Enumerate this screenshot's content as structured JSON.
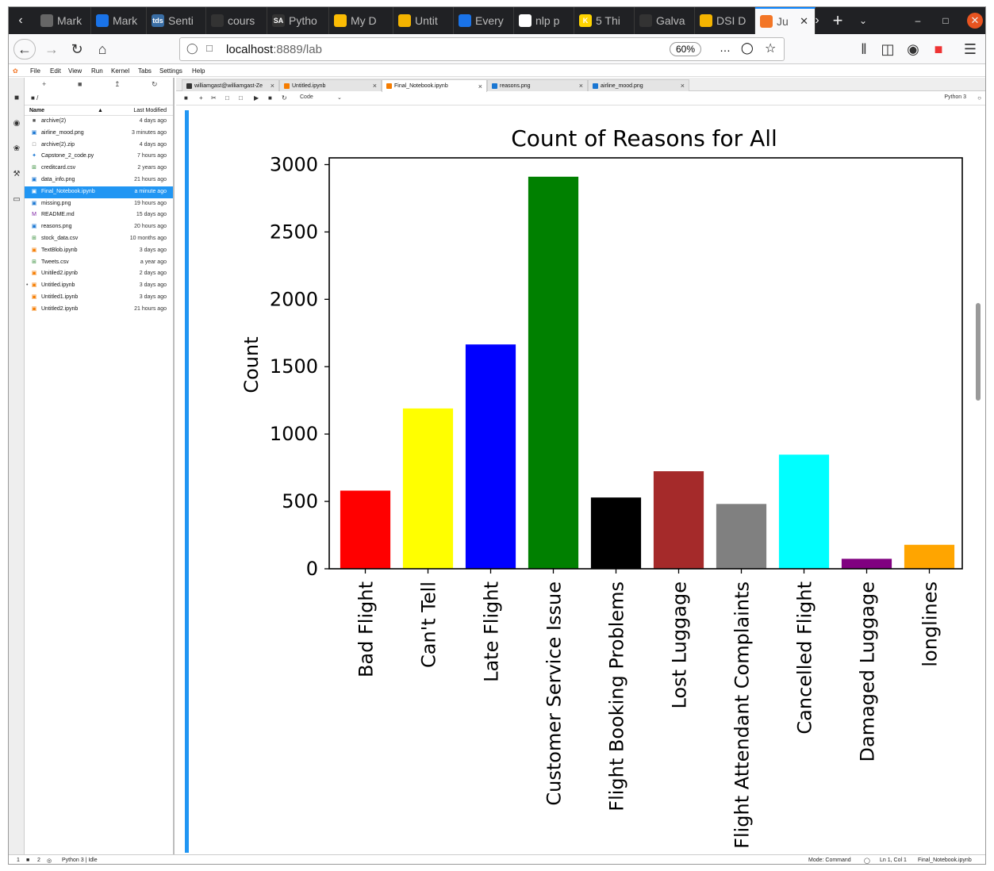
{
  "browser": {
    "tabs": [
      {
        "label": "Mark",
        "color": "#666"
      },
      {
        "label": "Mark",
        "color": "#1a73e8"
      },
      {
        "label": "Senti",
        "color": "#3a6ea5",
        "badge": "tds"
      },
      {
        "label": "cours",
        "color": "#333"
      },
      {
        "label": "Pytho",
        "color": "#333",
        "badge": "SA"
      },
      {
        "label": "My D",
        "color": "#fbbc04"
      },
      {
        "label": "Untit",
        "color": "#f4b400"
      },
      {
        "label": "Every",
        "color": "#1a73e8"
      },
      {
        "label": "nlp p",
        "color": "#fff"
      },
      {
        "label": "5 Thi",
        "color": "#ffd400",
        "badge": "K"
      },
      {
        "label": "Galva",
        "color": "#333"
      },
      {
        "label": "DSI D",
        "color": "#f4b400"
      },
      {
        "label": "Ju",
        "color": "#f37626"
      }
    ],
    "url_host": "localhost",
    "url_path": ":8889/lab",
    "zoom": "60%"
  },
  "menu": [
    "File",
    "Edit",
    "View",
    "Run",
    "Kernel",
    "Tabs",
    "Settings",
    "Help"
  ],
  "filebrowser": {
    "breadcrumb": "/",
    "col_name": "Name",
    "col_modified": "Last Modified",
    "files": [
      {
        "name": "archive(2)",
        "modified": "4 days ago",
        "type": "folder"
      },
      {
        "name": "airline_mood.png",
        "modified": "3 minutes ago",
        "type": "image"
      },
      {
        "name": "archive(2).zip",
        "modified": "4 days ago",
        "type": "file"
      },
      {
        "name": "Capstone_2_code.py",
        "modified": "7 hours ago",
        "type": "python"
      },
      {
        "name": "creditcard.csv",
        "modified": "2 years ago",
        "type": "csv"
      },
      {
        "name": "data_info.png",
        "modified": "21 hours ago",
        "type": "image"
      },
      {
        "name": "Final_Notebook.ipynb",
        "modified": "a minute ago",
        "type": "notebook",
        "selected": true
      },
      {
        "name": "missing.png",
        "modified": "19 hours ago",
        "type": "image"
      },
      {
        "name": "README.md",
        "modified": "15 days ago",
        "type": "markdown"
      },
      {
        "name": "reasons.png",
        "modified": "20 hours ago",
        "type": "image"
      },
      {
        "name": "stock_data.csv",
        "modified": "10 months ago",
        "type": "csv"
      },
      {
        "name": "TextBlob.ipynb",
        "modified": "3 days ago",
        "type": "notebook"
      },
      {
        "name": "Tweets.csv",
        "modified": "a year ago",
        "type": "csv"
      },
      {
        "name": "Unitiled2.ipynb",
        "modified": "2 days ago",
        "type": "notebook"
      },
      {
        "name": "Untitled.ipynb",
        "modified": "3 days ago",
        "type": "notebook",
        "running": true
      },
      {
        "name": "Untitled1.ipynb",
        "modified": "3 days ago",
        "type": "notebook"
      },
      {
        "name": "Untitled2.ipynb",
        "modified": "21 hours ago",
        "type": "notebook"
      }
    ]
  },
  "doc_tabs": [
    {
      "label": "williamgast@williamgast-Ze",
      "type": "terminal"
    },
    {
      "label": "Untitled.ipynb",
      "type": "notebook"
    },
    {
      "label": "Final_Notebook.ipynb",
      "type": "notebook",
      "active": true
    },
    {
      "label": "reasons.png",
      "type": "image"
    },
    {
      "label": "airline_mood.png",
      "type": "image"
    }
  ],
  "notebook_toolbar": {
    "cell_type": "Code",
    "kernel": "Python 3"
  },
  "status": {
    "left_a": "1",
    "left_b": "2",
    "kernel": "Python 3 | Idle",
    "mode": "Mode: Command",
    "position": "Ln 1, Col 1",
    "file": "Final_Notebook.ipynb"
  },
  "chart_data": {
    "type": "bar",
    "title": "Count of Reasons for All",
    "xlabel": "",
    "ylabel": "Count",
    "ylim": [
      0,
      3050
    ],
    "yticks": [
      0,
      500,
      1000,
      1500,
      2000,
      2500,
      3000
    ],
    "categories": [
      "Bad Flight",
      "Can't Tell",
      "Late Flight",
      "Customer Service Issue",
      "Flight Booking Problems",
      "Lost Luggage",
      "Flight Attendant Complaints",
      "Cancelled Flight",
      "Damaged Luggage",
      "longlines"
    ],
    "values": [
      580,
      1190,
      1665,
      2910,
      529,
      724,
      481,
      847,
      74,
      178
    ],
    "colors": [
      "#ff0000",
      "#ffff00",
      "#0000ff",
      "#008000",
      "#000000",
      "#a52a2a",
      "#808080",
      "#00ffff",
      "#800080",
      "#ffa500"
    ]
  }
}
